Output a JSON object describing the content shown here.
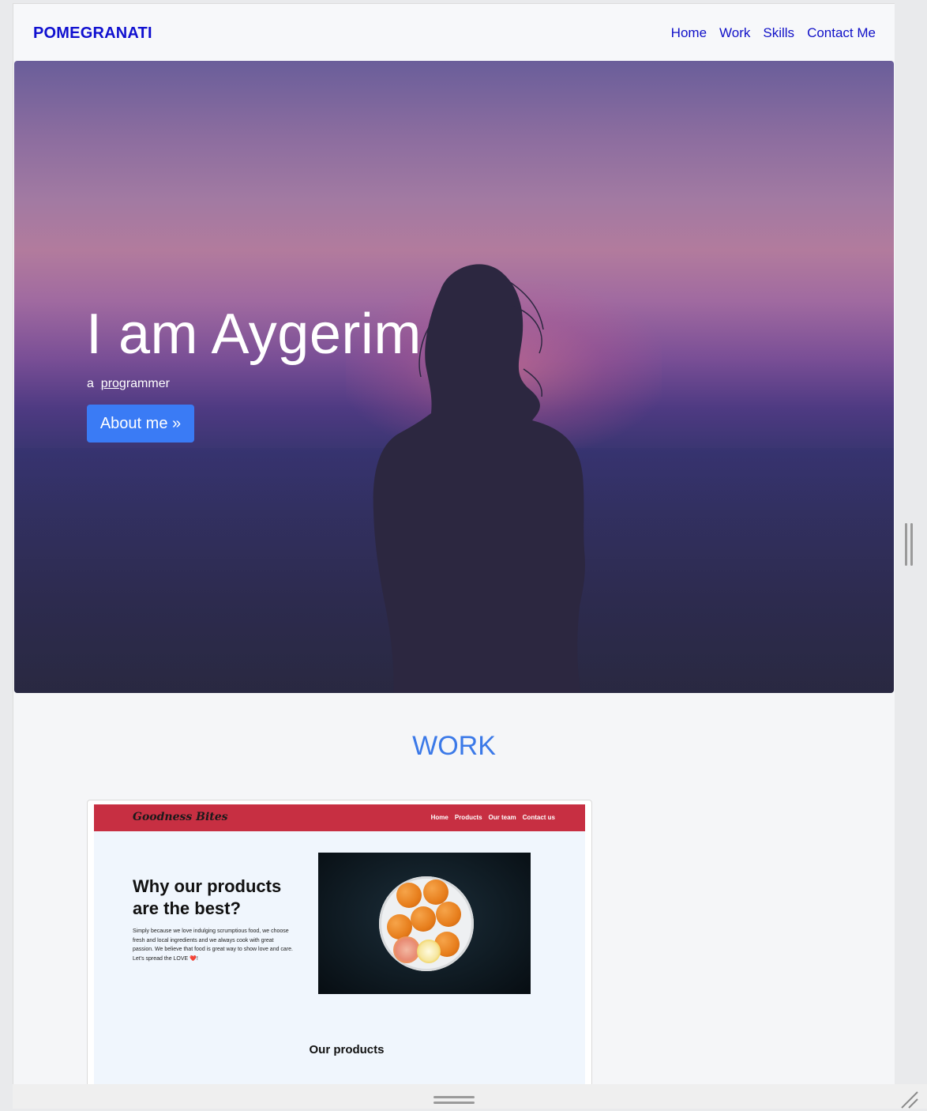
{
  "navbar": {
    "brand": "POMEGRANATI",
    "links": [
      "Home",
      "Work",
      "Skills",
      "Contact Me"
    ]
  },
  "hero": {
    "title": "I am Aygerim",
    "subtitle_prefix": "a",
    "subtitle_typed": "pro",
    "subtitle_rest": "grammer",
    "button_label": "About me »"
  },
  "work": {
    "heading": "WORK",
    "project": {
      "brand": "Goodness Bites",
      "nav_links": [
        "Home",
        "Products",
        "Our team",
        "Contact us"
      ],
      "heading": "Why our products are the best?",
      "text": "Simply because we love indulging scrumptious food, we choose fresh and local ingredients and we always cook with great passion. We believe that food is great way to show love and care.",
      "text_line2": "Let's spread the LOVE ❤️!",
      "subheading": "Our products"
    }
  },
  "colors": {
    "brand": "#1010d0",
    "accent": "#3a7bf5",
    "work_heading": "#3b79e8",
    "project_nav": "#c72f42"
  }
}
